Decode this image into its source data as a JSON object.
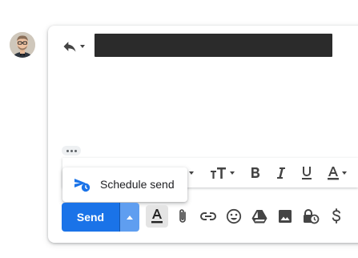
{
  "compose": {
    "popup": {
      "label": "Schedule send",
      "icon": "schedule-send-icon"
    },
    "send": {
      "label": "Send",
      "split_icon": "caret-up-icon"
    },
    "format_toolbar": [
      {
        "name": "font-size-icon"
      },
      {
        "name": "bold-icon"
      },
      {
        "name": "italic-icon"
      },
      {
        "name": "underline-icon"
      },
      {
        "name": "text-color-icon"
      }
    ],
    "bottom_tools": [
      {
        "name": "formatting-options-icon"
      },
      {
        "name": "attach-file-icon"
      },
      {
        "name": "insert-link-icon"
      },
      {
        "name": "insert-emoji-icon"
      },
      {
        "name": "google-drive-icon"
      },
      {
        "name": "insert-photo-icon"
      },
      {
        "name": "confidential-mode-icon"
      },
      {
        "name": "insert-money-icon"
      }
    ],
    "colors": {
      "accent": "#1a73e8",
      "split": "#5f9ef0",
      "icon": "#444444"
    }
  }
}
